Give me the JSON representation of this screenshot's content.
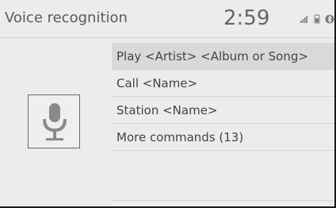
{
  "header": {
    "title": "Voice recognition",
    "time": "2:59",
    "icons": [
      "signal-icon",
      "battery-icon",
      "bluetooth-icon"
    ]
  },
  "menu": {
    "items": [
      {
        "label": "Play <Artist> <Album or Song>",
        "selected": true
      },
      {
        "label": "Call <Name>",
        "selected": false
      },
      {
        "label": "Station <Name>",
        "selected": false
      },
      {
        "label": "More commands (13)",
        "selected": false
      }
    ]
  },
  "colors": {
    "background": "#ececec",
    "selected_row": "#d9d9d9",
    "text": "#444444"
  }
}
